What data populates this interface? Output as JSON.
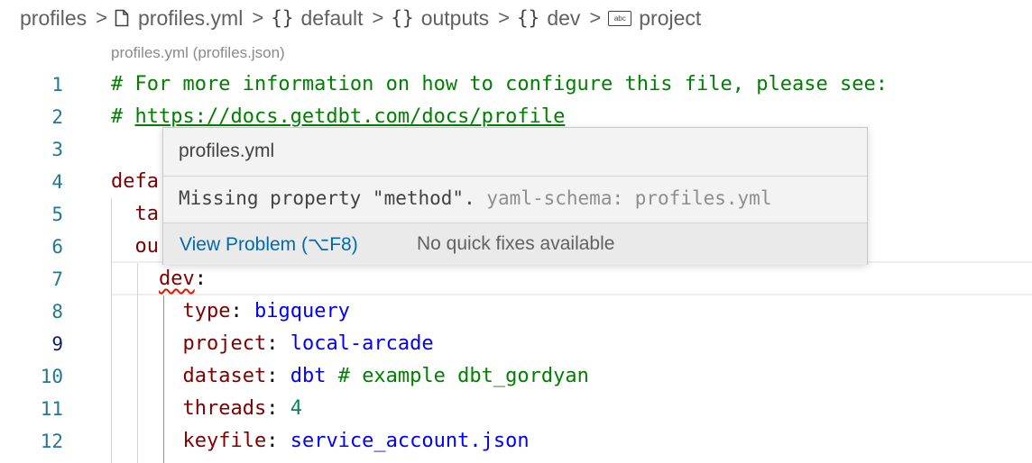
{
  "breadcrumb": {
    "items": [
      {
        "label": "profiles",
        "icon": ""
      },
      {
        "label": "profiles.yml",
        "icon": "file-icon"
      },
      {
        "label": "default",
        "icon": "braces-icon"
      },
      {
        "label": "outputs",
        "icon": "braces-icon"
      },
      {
        "label": "dev",
        "icon": "braces-icon"
      },
      {
        "label": "project",
        "icon": "string-icon"
      }
    ],
    "separator": ">",
    "braces_glyph": "{}",
    "abc_glyph": "abc"
  },
  "codelens": "profiles.yml (profiles.json)",
  "editor": {
    "active_line": 9,
    "lines": [
      {
        "n": "1",
        "tokens": [
          {
            "t": "# For more information on how to configure this file, please see:",
            "c": "cm"
          }
        ]
      },
      {
        "n": "2",
        "tokens": [
          {
            "t": "# ",
            "c": "cm"
          },
          {
            "t": "https://docs.getdbt.com/docs/profile",
            "c": "cm link"
          }
        ]
      },
      {
        "n": "3",
        "tokens": []
      },
      {
        "n": "4",
        "tokens": [
          {
            "t": "defa",
            "c": "key"
          }
        ]
      },
      {
        "n": "5",
        "tokens": [
          {
            "t": "  ta",
            "c": "key"
          }
        ]
      },
      {
        "n": "6",
        "tokens": [
          {
            "t": "  ou",
            "c": "key"
          }
        ]
      },
      {
        "n": "7",
        "tokens": [
          {
            "t": "    ",
            "c": "punc"
          },
          {
            "t": "dev",
            "c": "key squiggle"
          },
          {
            "t": ":",
            "c": "punc"
          }
        ]
      },
      {
        "n": "8",
        "tokens": [
          {
            "t": "      ",
            "c": "punc"
          },
          {
            "t": "type",
            "c": "key"
          },
          {
            "t": ": ",
            "c": "punc"
          },
          {
            "t": "bigquery",
            "c": "val"
          }
        ]
      },
      {
        "n": "9",
        "tokens": [
          {
            "t": "      ",
            "c": "punc"
          },
          {
            "t": "project",
            "c": "key"
          },
          {
            "t": ": ",
            "c": "punc"
          },
          {
            "t": "local-arcade",
            "c": "val"
          }
        ]
      },
      {
        "n": "10",
        "tokens": [
          {
            "t": "      ",
            "c": "punc"
          },
          {
            "t": "dataset",
            "c": "key"
          },
          {
            "t": ": ",
            "c": "punc"
          },
          {
            "t": "dbt",
            "c": "val"
          },
          {
            "t": " # example dbt_gordyan",
            "c": "cm"
          }
        ]
      },
      {
        "n": "11",
        "tokens": [
          {
            "t": "      ",
            "c": "punc"
          },
          {
            "t": "threads",
            "c": "key"
          },
          {
            "t": ": ",
            "c": "punc"
          },
          {
            "t": "4",
            "c": "num"
          }
        ]
      },
      {
        "n": "12",
        "tokens": [
          {
            "t": "      ",
            "c": "punc"
          },
          {
            "t": "keyfile",
            "c": "key"
          },
          {
            "t": ": ",
            "c": "punc"
          },
          {
            "t": "service_account.json",
            "c": "val"
          }
        ]
      }
    ]
  },
  "hover": {
    "title": "profiles.yml",
    "message": "Missing property \"method\".",
    "source": "yaml-schema: profiles.yml",
    "view_problem": "View Problem (⌥F8)",
    "no_fixes": "No quick fixes available"
  },
  "colors": {
    "line_number": "#237893",
    "comment": "#008000",
    "key": "#800000",
    "value": "#0000ff",
    "number": "#098658",
    "error_squiggle": "#e51400",
    "link": "#006ab1"
  }
}
